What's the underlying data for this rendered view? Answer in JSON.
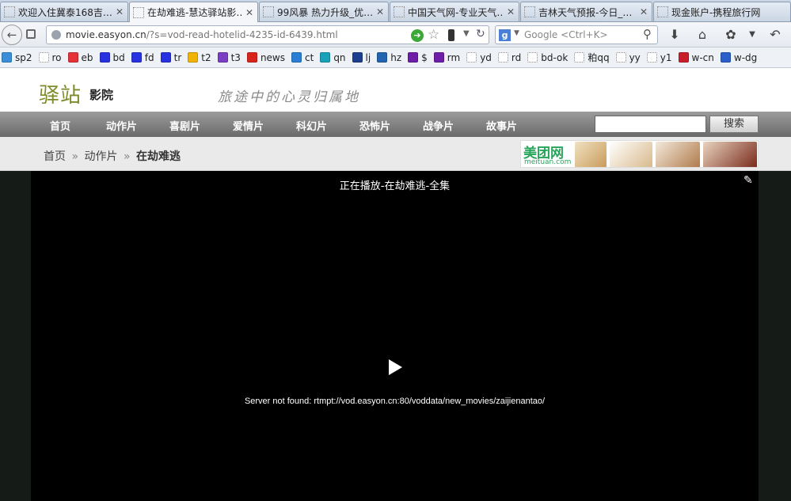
{
  "browser": {
    "tabs": [
      {
        "title": "欢迎入住冀泰168吉…",
        "active": false
      },
      {
        "title": "在劫难逃-慧达驿站影…",
        "active": true
      },
      {
        "title": "99风暴 热力升级_优…",
        "active": false
      },
      {
        "title": "中国天气网-专业天气…",
        "active": false
      },
      {
        "title": "吉林天气预报-今日_…",
        "active": false
      },
      {
        "title": "现金账户-携程旅行网",
        "active": false
      }
    ],
    "url_host": "movie.easyon.cn",
    "url_path": "/?s=vod-read-hotelid-4235-id-6439.html",
    "search_placeholder": "Google <Ctrl+K>",
    "bookmarks": [
      {
        "label": "sp2",
        "icon": "sp2-icon",
        "color": "#3a8fd8"
      },
      {
        "label": "ro",
        "icon": "blank-page-icon",
        "color": "#ffffff"
      },
      {
        "label": "eb",
        "icon": "ebay-icon",
        "color": "#e53238"
      },
      {
        "label": "bd",
        "icon": "baidu-paw-icon",
        "color": "#2932e1"
      },
      {
        "label": "fd",
        "icon": "baidu-paw-icon",
        "color": "#2932e1"
      },
      {
        "label": "tr",
        "icon": "baidu-paw-icon",
        "color": "#2932e1"
      },
      {
        "label": "t2",
        "icon": "m-coin-icon",
        "color": "#f0b400"
      },
      {
        "label": "t3",
        "icon": "hand-icon",
        "color": "#7a3fc2"
      },
      {
        "label": "news",
        "icon": "zhong-icon",
        "color": "#d9241b"
      },
      {
        "label": "ct",
        "icon": "ctrip-icon",
        "color": "#2a7fd4"
      },
      {
        "label": "qn",
        "icon": "qunar-icon",
        "color": "#1aa0b8"
      },
      {
        "label": "lj",
        "icon": "shield-icon",
        "color": "#1c3f8f"
      },
      {
        "label": "hz",
        "icon": "hz-icon",
        "color": "#2364b0"
      },
      {
        "label": "$",
        "icon": "yahoo-icon",
        "color": "#6d1fa8"
      },
      {
        "label": "rm",
        "icon": "yahoo-icon",
        "color": "#6d1fa8"
      },
      {
        "label": "yd",
        "icon": "blank-page-icon",
        "color": "#ffffff"
      },
      {
        "label": "rd",
        "icon": "blank-page-icon",
        "color": "#ffffff"
      },
      {
        "label": "bd-ok",
        "icon": "blank-page-icon",
        "color": "#ffffff"
      },
      {
        "label": "粕qq",
        "icon": "blank-page-icon",
        "color": "#ffffff"
      },
      {
        "label": "yy",
        "icon": "blank-page-icon",
        "color": "#ffffff"
      },
      {
        "label": "y1",
        "icon": "blank-page-icon",
        "color": "#ffffff"
      },
      {
        "label": "w-cn",
        "icon": "weather-icon",
        "color": "#c8202a"
      },
      {
        "label": "w-dg",
        "icon": "weather-e-icon",
        "color": "#2a60c8"
      }
    ]
  },
  "site": {
    "logo_main": "驿站",
    "logo_sub": "影院",
    "slogan": "旅途中的心灵归属地",
    "nav": [
      "首页",
      "动作片",
      "喜剧片",
      "爱情片",
      "科幻片",
      "恐怖片",
      "战争片",
      "故事片"
    ],
    "search_button": "搜索",
    "search_value": "",
    "breadcrumb": {
      "home": "首页",
      "sep": "»",
      "category": "动作片",
      "current": "在劫难逃"
    },
    "ad": {
      "brand": "美团网",
      "domain": "meituan.com"
    }
  },
  "player": {
    "now_playing": "正在播放-在劫难逃-全集",
    "error": "Server not found: rtmpt://vod.easyon.cn:80/voddata/new_movies/zaijienantao/"
  }
}
